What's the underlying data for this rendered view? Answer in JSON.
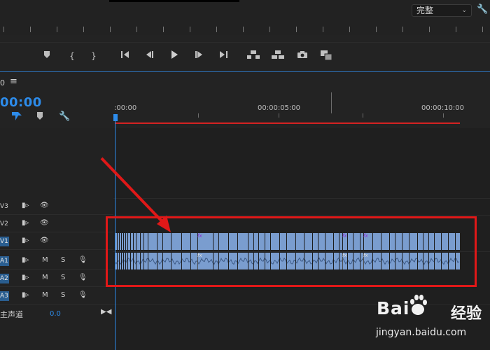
{
  "monitor": {
    "quality": "完整",
    "wrench_icon": "wrench-icon",
    "transport_icons": [
      "marker-icon",
      "mark-in-icon",
      "mark-out-icon",
      "go-to-in-icon",
      "step-back-icon",
      "play-icon",
      "step-forward-icon",
      "go-to-out-icon",
      "lift-icon",
      "extract-icon",
      "camera-icon",
      "multi-icon"
    ]
  },
  "timeline": {
    "sequence_num": "0",
    "menu_icon": "≡",
    "timecode": "00:00",
    "ruler": {
      "labels": [
        ":00:00",
        "00:00:05:00",
        "00:00:10:00"
      ]
    },
    "tracks": [
      {
        "name": "V3",
        "kind": "video"
      },
      {
        "name": "V2",
        "kind": "video"
      },
      {
        "name": "V1",
        "kind": "video"
      },
      {
        "name": "A1",
        "kind": "audio",
        "m": "M",
        "s": "S"
      },
      {
        "name": "A2",
        "kind": "audio",
        "m": "M",
        "s": "S"
      },
      {
        "name": "A3",
        "kind": "audio",
        "m": "M",
        "s": "S"
      }
    ],
    "master": {
      "label": "主声道",
      "value": "0.0"
    },
    "fx_label": "fx"
  },
  "watermark": {
    "brand": "Bai",
    "suffix": "经验",
    "url": "jingyan.baidu.com"
  },
  "colors": {
    "accent": "#2d8ceb",
    "clip": "#7a9dcf",
    "highlight": "#e01818"
  }
}
